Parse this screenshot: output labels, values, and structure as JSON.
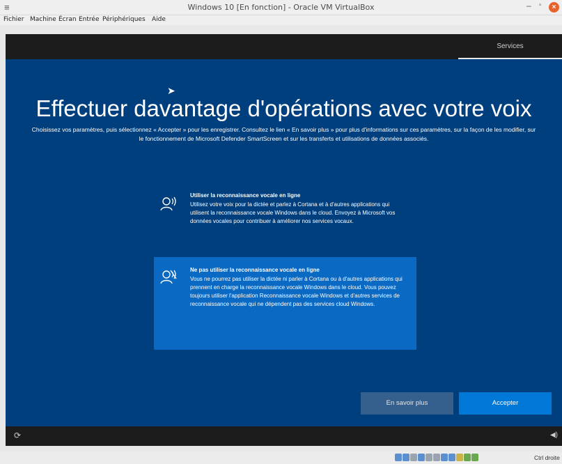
{
  "window": {
    "title": "Windows 10 [En fonction] - Oracle VM VirtualBox",
    "menu_icon": "hamburger-icon",
    "minimize": "–",
    "maximize": "▫",
    "close": "×"
  },
  "menu": [
    "Fichier",
    "Machine",
    "Écran",
    "Entrée",
    "Périphériques",
    "Aide"
  ],
  "vm": {
    "top_tab": "Services",
    "heading": "Effectuer davantage d'opérations avec votre voix",
    "subtext": "Choisissez vos paramètres, puis sélectionnez « Accepter » pour les enregistrer. Consultez le lien « En savoir plus » pour plus d'informations sur ces paramètres, sur la façon de les modifier, sur le fonctionnement de Microsoft Defender SmartScreen et sur les transferts et utilisations de données associés.",
    "options": [
      {
        "title": "Utiliser la reconnaissance vocale en ligne",
        "description": "Utilisez votre voix pour la dictée et parlez à Cortana et à d'autres applications qui utilisent la reconnaissance vocale Windows dans le cloud. Envoyez à Microsoft vos données vocales pour contribuer à améliorer nos services vocaux.",
        "selected": false,
        "icon": "speech-recognition-icon"
      },
      {
        "title": "Ne pas utiliser la reconnaissance vocale en ligne",
        "description": "Vous ne pourrez pas utiliser la dictée ni parler à Cortana ou à d'autres applications qui prennent en charge la reconnaissance vocale Windows dans le cloud. Vous pouvez toujours utiliser l'application Reconnaissance vocale Windows et d'autres services de reconnaissance vocale qui ne dépendent pas des services cloud Windows.",
        "selected": true,
        "icon": "speech-recognition-off-icon"
      }
    ],
    "buttons": {
      "learn_more": "En savoir plus",
      "accept": "Accepter"
    }
  },
  "status": {
    "host_key": "Ctrl droite"
  },
  "colors": {
    "oobe_background": "#003f7d",
    "selected_option": "#0a69c2",
    "accept_button": "#0078d7",
    "learn_more_button": "#355f8d",
    "close_button": "#e8632b"
  }
}
